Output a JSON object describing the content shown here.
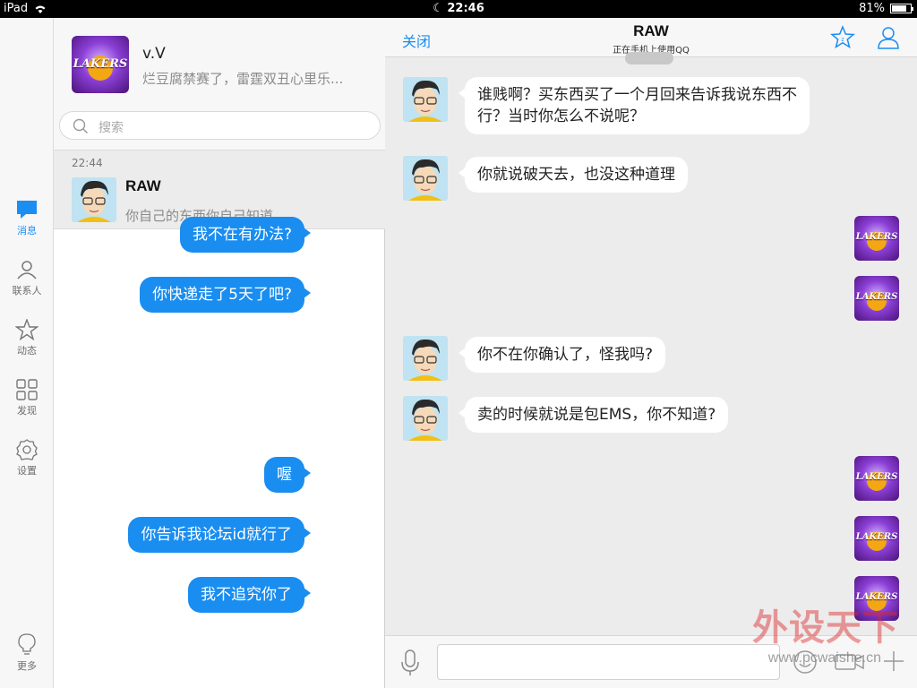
{
  "statusbar": {
    "device": "iPad",
    "time": "22:46",
    "battery": "81%",
    "battery_level": 0.81
  },
  "rail": {
    "items": [
      {
        "label": "消息",
        "icon": "message-icon"
      },
      {
        "label": "联系人",
        "icon": "contacts-icon"
      },
      {
        "label": "动态",
        "icon": "star-icon"
      },
      {
        "label": "发现",
        "icon": "grid-icon"
      },
      {
        "label": "设置",
        "icon": "gear-icon"
      },
      {
        "label": "更多",
        "icon": "lightbulb-icon"
      }
    ]
  },
  "top_contact": {
    "name": "v.V",
    "snippet": "烂豆腐禁赛了，雷霆双丑心里乐...",
    "avatar_text": "LAKERS"
  },
  "search": {
    "placeholder": "搜索"
  },
  "conversation": {
    "time": "22:44",
    "name": "RAW",
    "last_message": "你自己的东西你自己知道"
  },
  "chat": {
    "close_label": "关闭",
    "title": "RAW",
    "subtitle": "正在手机上使用QQ",
    "messages": [
      {
        "from": "in",
        "line1": "谁贱啊？买东西买了一个月回来告诉我说东西不",
        "line2": "行？当时你怎么不说呢？"
      },
      {
        "from": "in",
        "text": "你就说破天去，也没这种道理"
      },
      {
        "from": "out",
        "text": "我不在有办法?"
      },
      {
        "from": "out",
        "text": "你快递走了5天了吧?"
      },
      {
        "from": "in",
        "text": "你不在你确认了，怪我吗?"
      },
      {
        "from": "in",
        "text": "卖的时候就说是包EMS，你不知道?"
      },
      {
        "from": "out",
        "text": "喔"
      },
      {
        "from": "out",
        "text": "你告诉我论坛id就行了"
      },
      {
        "from": "out",
        "text": "我不追究你了"
      }
    ]
  },
  "watermark": {
    "text": "外设天下",
    "url": "www.pcwaishe.cn"
  },
  "colors": {
    "accent": "#1b8ef2",
    "out_bubble": "#1a8df0",
    "in_bubble": "#ffffff"
  }
}
